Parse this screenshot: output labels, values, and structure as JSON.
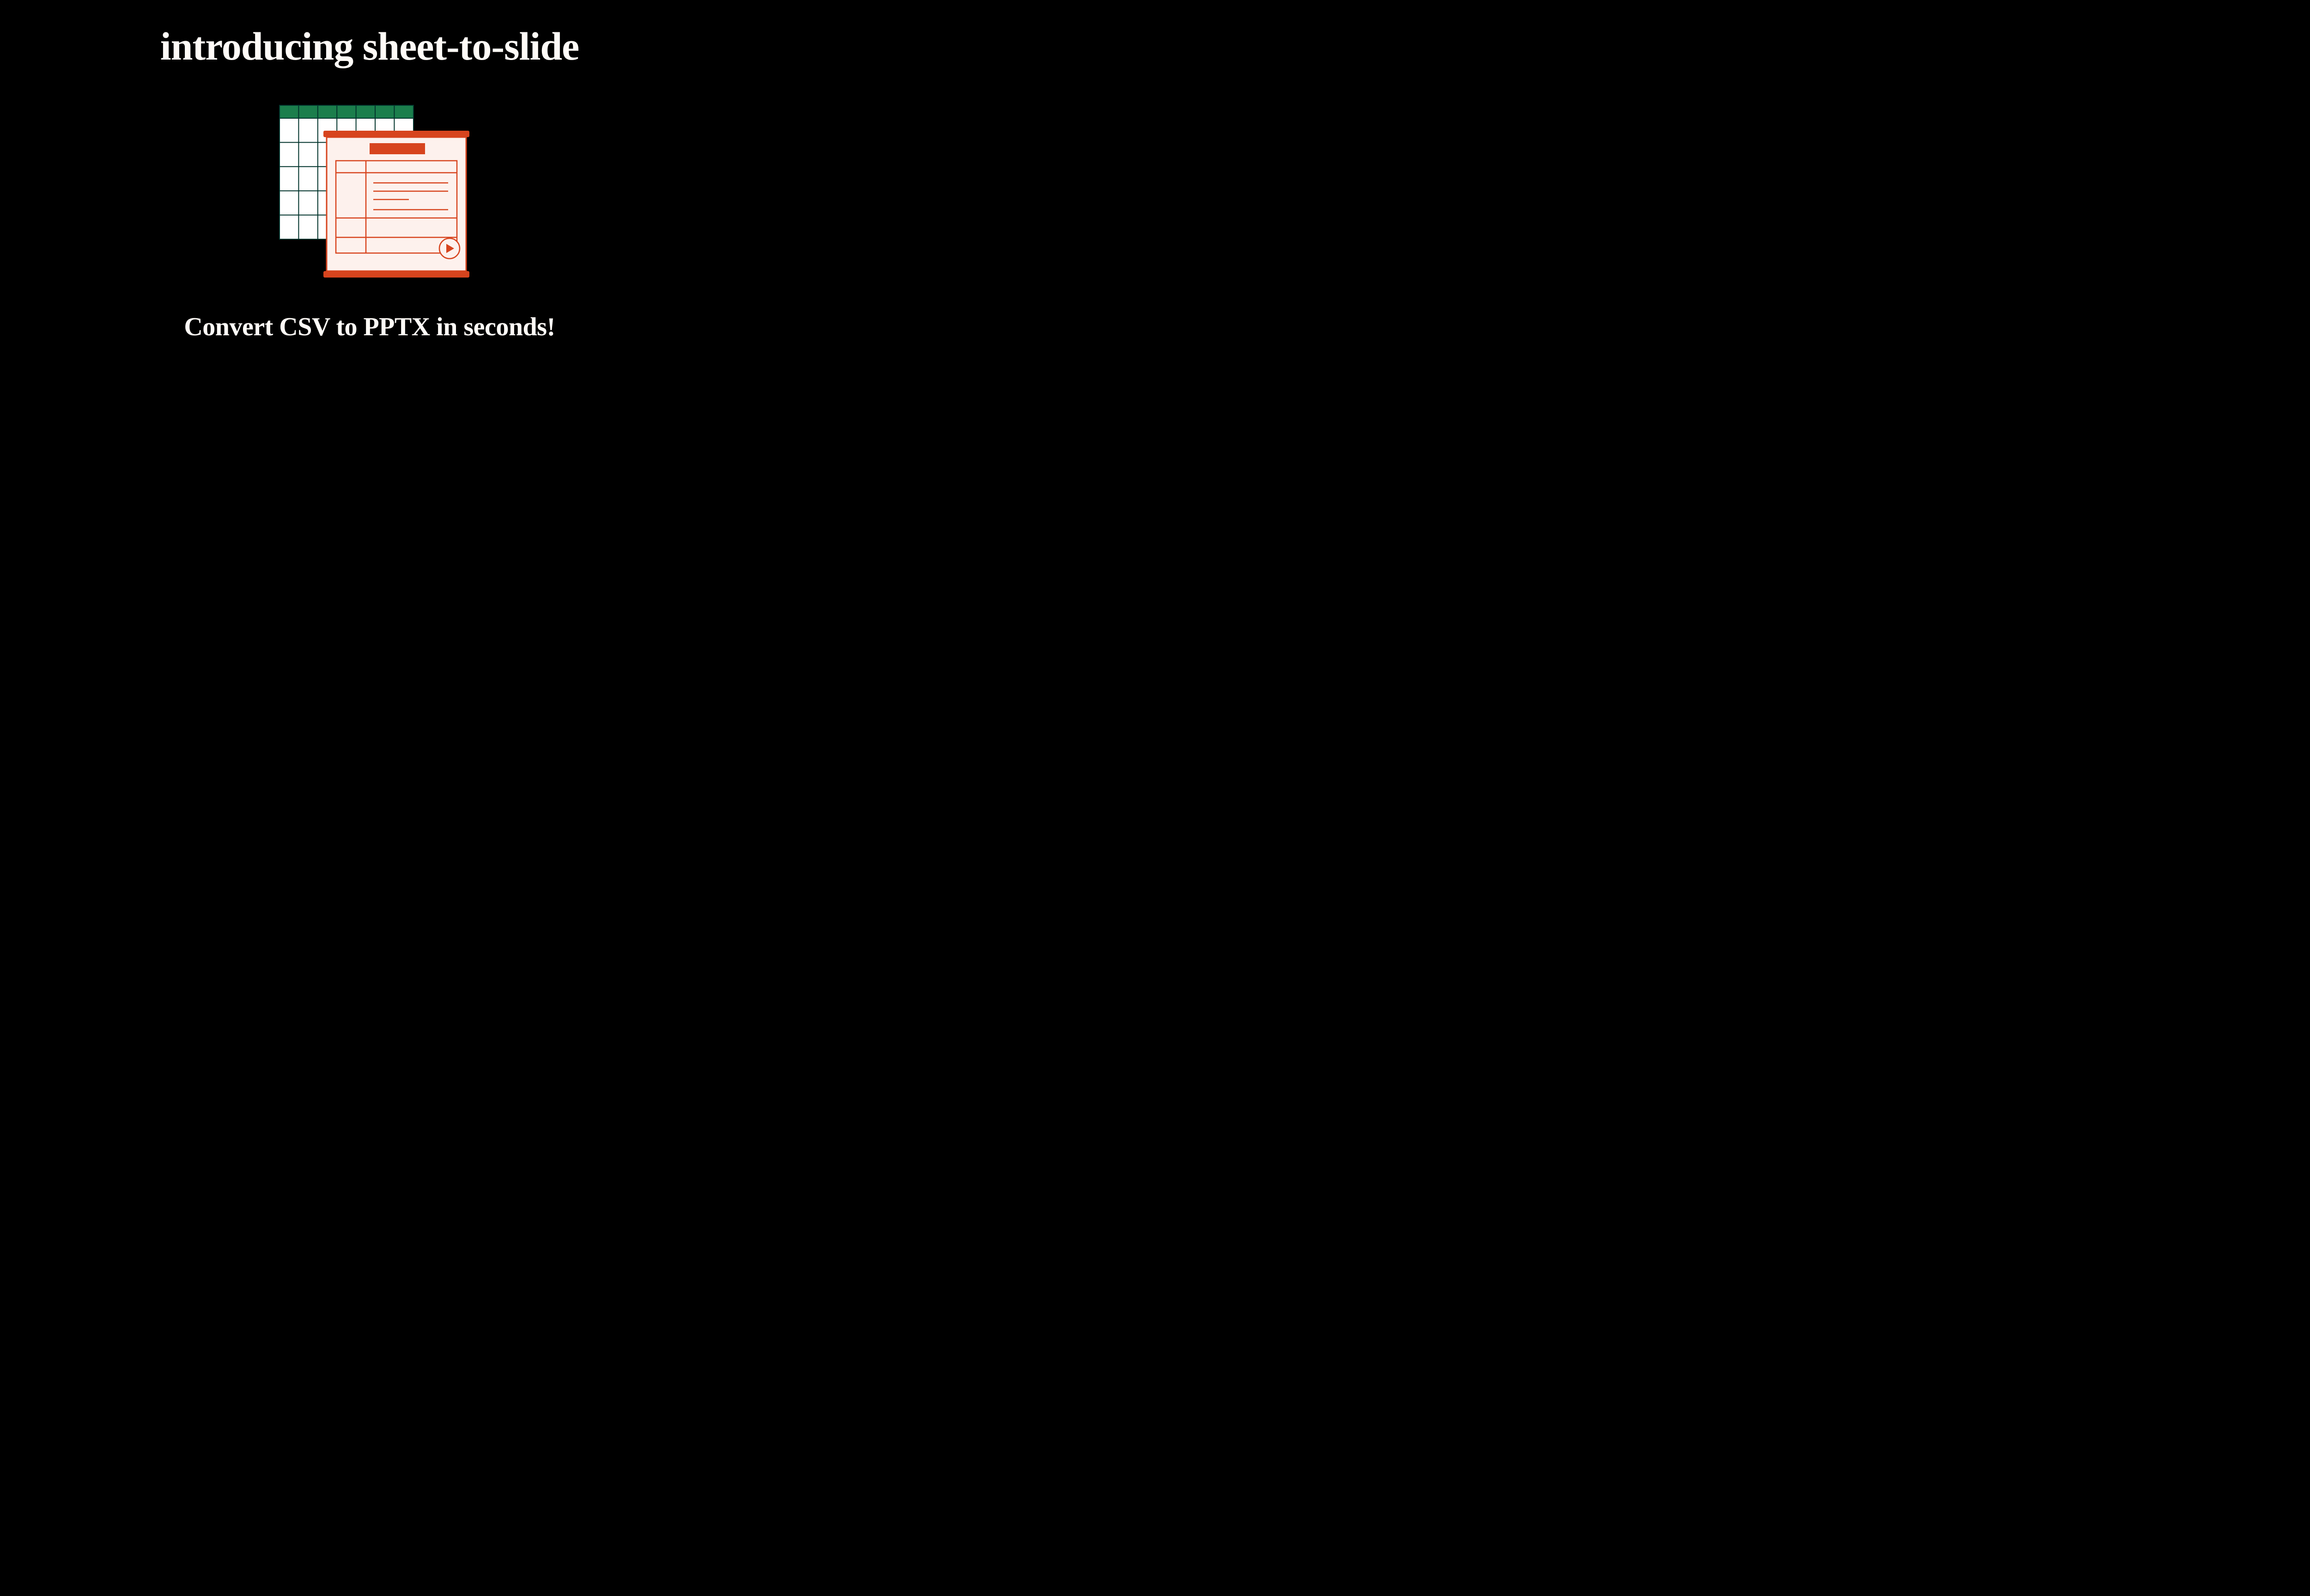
{
  "headline": "introducing sheet-to-slide",
  "tagline": "Convert CSV to PPTX in seconds!",
  "colors": {
    "background": "#000000",
    "text": "#fffbf7",
    "spreadsheet_header": "#1b7e4c",
    "spreadsheet_body": "#ffffff",
    "spreadsheet_border": "#02342c",
    "slide_frame": "#d7441e",
    "slide_body": "#fdf1ed"
  }
}
